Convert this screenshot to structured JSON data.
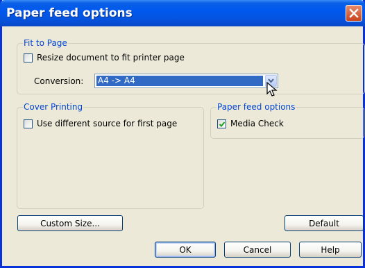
{
  "window": {
    "title": "Paper feed options"
  },
  "fit_to_page": {
    "label": "Fit to Page",
    "resize_checkbox": {
      "label": "Resize document to fit printer page",
      "checked": false
    },
    "conversion": {
      "label": "Conversion:",
      "value": "A4 -> A4"
    }
  },
  "cover_printing": {
    "label": "Cover Printing",
    "checkbox": {
      "label": "Use different source for first page",
      "checked": false
    }
  },
  "paper_feed": {
    "label": "Paper feed options",
    "media_check": {
      "label": "Media Check",
      "checked": true
    }
  },
  "buttons": {
    "custom_size": "Custom Size...",
    "default": "Default",
    "ok": "OK",
    "cancel": "Cancel",
    "help": "Help"
  },
  "colors": {
    "title_bar": "#0058EE",
    "group_label": "#0046D5",
    "selection": "#316AC5",
    "dialog_bg": "#ECE9D8"
  }
}
